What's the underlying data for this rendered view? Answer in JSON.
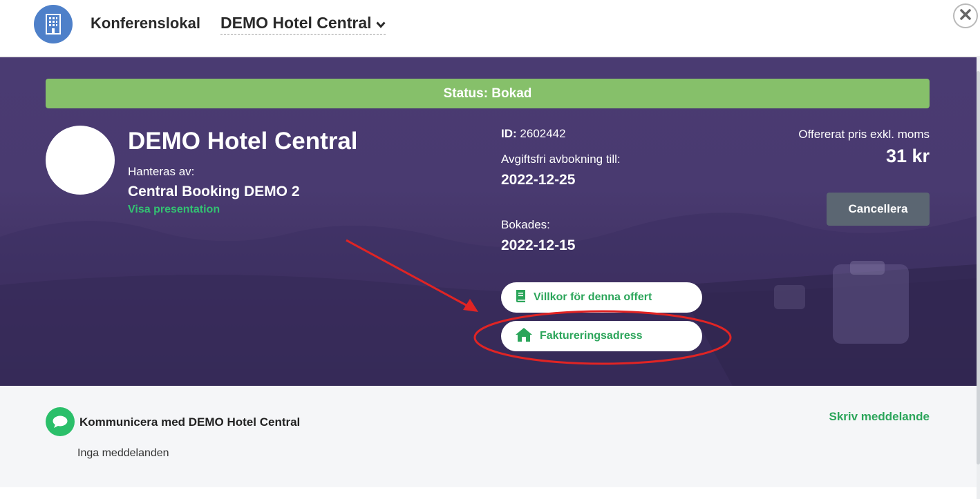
{
  "header": {
    "section_label": "Konferenslokal",
    "venue_select": "DEMO Hotel Central",
    "icons": {
      "hotel": "building-icon",
      "chevron": "chevron-down-icon",
      "close": "close-icon"
    }
  },
  "hero": {
    "status": "Status: Bokad",
    "venue_title": "DEMO Hotel Central",
    "managed_label": "Hanteras av:",
    "managed_name": "Central Booking DEMO 2",
    "presentation_link": "Visa presentation",
    "id_label": "ID:",
    "id_value": "2602442",
    "cancel_free_label": "Avgiftsfri avbokning till:",
    "cancel_free_date": "2022-12-25",
    "booked_label": "Bokades:",
    "booked_date": "2022-12-15",
    "price_label": "Offererat pris exkl. moms",
    "price_value": "31 kr",
    "cancel_button": "Cancellera",
    "terms_button": "Villkor för denna offert",
    "billing_button": "Faktureringsadress",
    "icons": {
      "terms": "book-icon",
      "billing": "home-icon"
    }
  },
  "messages": {
    "title": "Kommunicera med DEMO Hotel Central",
    "write_link": "Skriv meddelande",
    "empty_text": "Inga meddelanden",
    "icon": "chat-bubble-icon"
  },
  "colors": {
    "status_green": "#86c06a",
    "hero_purple": "#4a3b72",
    "accent_green": "#2ba55a",
    "cancel_button_gray": "#5b6672",
    "annotation_red": "#e02424"
  }
}
